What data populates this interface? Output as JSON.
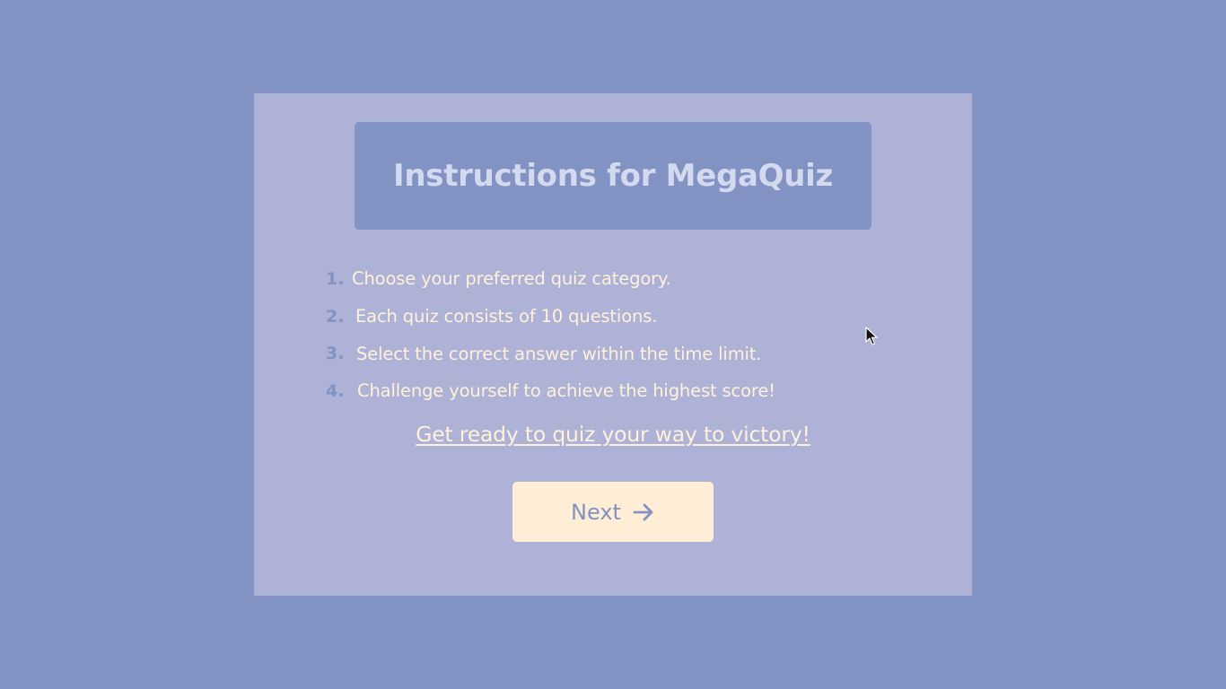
{
  "quiz": {
    "title": "Instructions for MegaQuiz",
    "steps": [
      {
        "number": "1.",
        "text": "Choose your preferred quiz category."
      },
      {
        "number": "2.",
        "text": "Each quiz consists of 10 questions."
      },
      {
        "number": "3.",
        "text": "Select the correct answer within the time limit."
      },
      {
        "number": "4.",
        "text": "Challenge yourself to achieve the highest score!"
      }
    ],
    "tagline": "Get ready to quiz your way to victory!",
    "next_label": "Next",
    "next_icon": "arrow-right-icon"
  },
  "colors": {
    "background": "#8293c3",
    "card": "#adb2d6",
    "title_box": "#8293c3",
    "title_text": "#d3d9ee",
    "step_number": "#8293c3",
    "body_text": "#fff1dc",
    "button_bg": "#ffedd5",
    "button_text": "#8293c3"
  }
}
